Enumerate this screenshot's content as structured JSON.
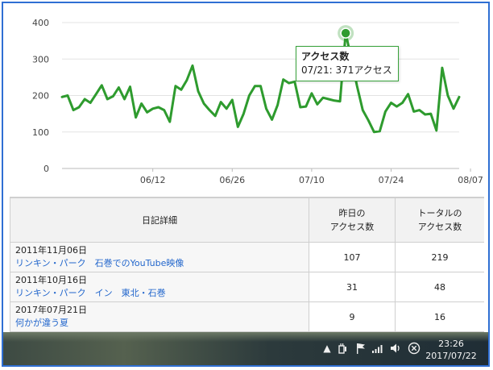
{
  "chart_data": {
    "type": "line",
    "color": "#2e9b2e",
    "y_ticks": [
      "0",
      "100",
      "200",
      "300",
      "400"
    ],
    "ylim": [
      0,
      400
    ],
    "x_ticks": [
      {
        "label": "06/12",
        "day_index": 16
      },
      {
        "label": "06/26",
        "day_index": 30
      },
      {
        "label": "07/10",
        "day_index": 44
      },
      {
        "label": "07/24",
        "day_index": 58
      },
      {
        "label": "08/07",
        "day_index": 72
      }
    ],
    "series": [
      {
        "values": [
          196,
          200,
          160,
          168,
          190,
          180,
          204,
          228,
          190,
          198,
          222,
          190,
          224,
          140,
          178,
          154,
          164,
          168,
          160,
          128,
          226,
          216,
          242,
          282,
          212,
          178,
          160,
          144,
          182,
          164,
          188,
          114,
          150,
          200,
          226,
          226,
          164,
          134,
          174,
          244,
          234,
          238,
          168,
          170,
          206,
          176,
          194,
          190,
          186,
          184,
          371,
          300,
          226,
          160,
          132,
          100,
          102,
          156,
          180,
          170,
          180,
          204,
          156,
          160,
          148,
          150,
          104,
          276,
          200,
          164,
          196
        ]
      }
    ],
    "highlight": {
      "index": 50,
      "value": 371
    }
  },
  "tooltip": {
    "title": "アクセス数",
    "body": "07/21: 371アクセス"
  },
  "table": {
    "headers": {
      "detail": "日記詳細",
      "yesterday_line1": "昨日の",
      "yesterday_line2": "アクセス数",
      "total_line1": "トータルの",
      "total_line2": "アクセス数"
    },
    "rows": [
      {
        "date": "2011年11月06日",
        "title": "リンキン・パーク　石巻でのYouTube映像",
        "yesterday": "107",
        "total": "219"
      },
      {
        "date": "2011年10月16日",
        "title": "リンキン・パーク　イン　東北・石巻",
        "yesterday": "31",
        "total": "48"
      },
      {
        "date": "2017年07月21日",
        "title": "何かが違う夏",
        "yesterday": "9",
        "total": "16"
      }
    ]
  },
  "taskbar": {
    "time": "23:26",
    "date": "2017/07/22"
  }
}
